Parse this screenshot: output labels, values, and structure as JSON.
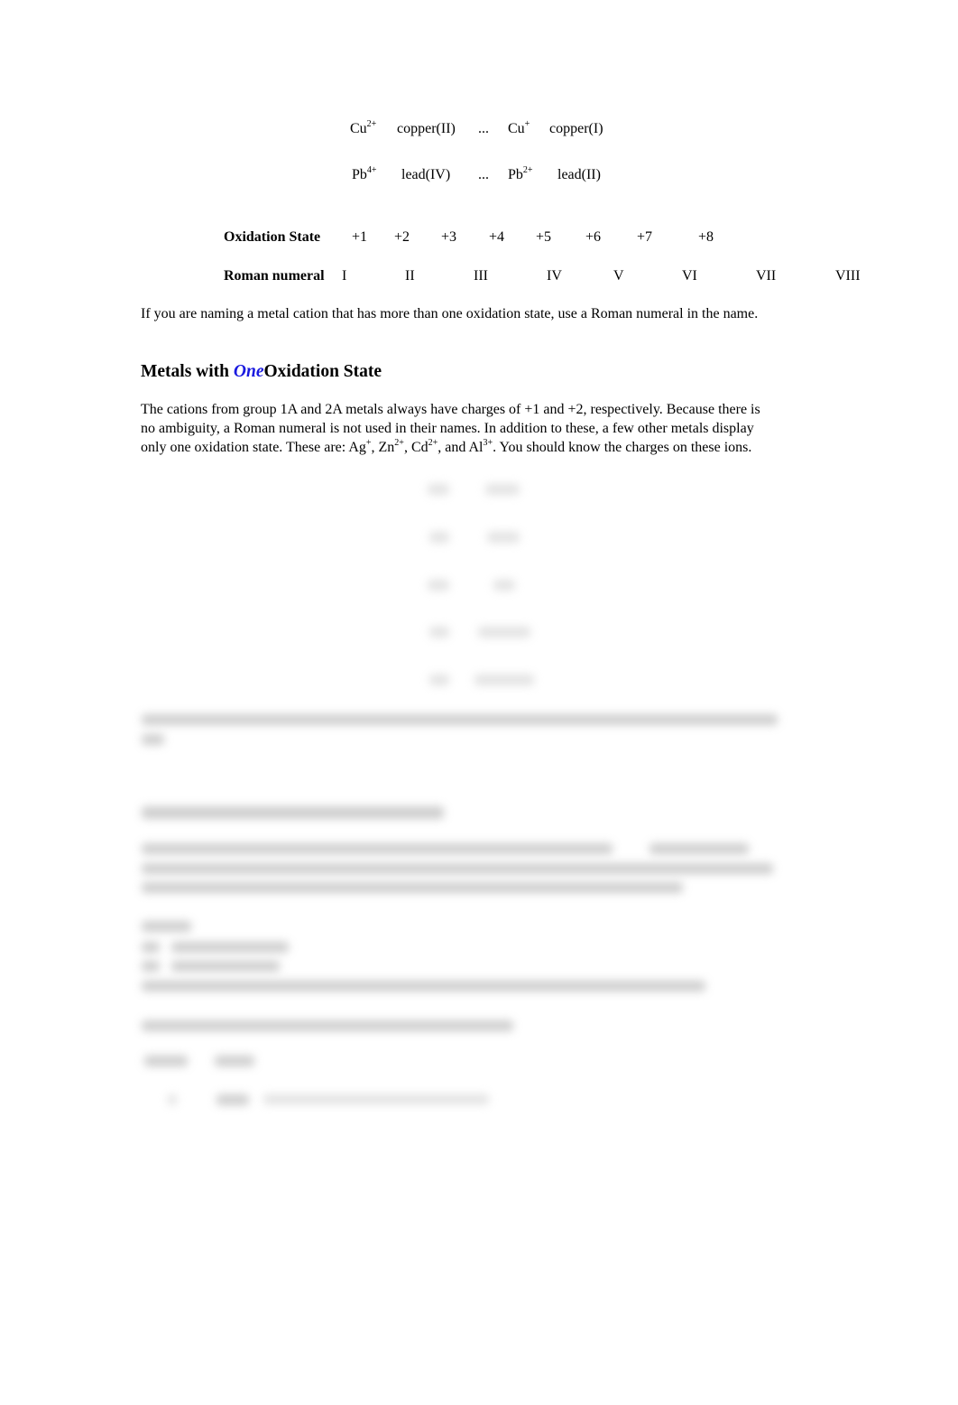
{
  "ion_examples": [
    {
      "ion1": "Cu",
      "charge1": "2+",
      "name1": "copper(II)",
      "sep": "...",
      "ion2": "Cu",
      "charge2": "+",
      "name2": "copper(I)"
    },
    {
      "ion1": "Pb",
      "charge1": "4+",
      "name1": "lead(IV)",
      "sep": "...",
      "ion2": "Pb",
      "charge2": "2+",
      "name2": "lead(II)"
    }
  ],
  "oxidation_table": {
    "state_label": "Oxidation State",
    "states": [
      "+1",
      "+2",
      "+3",
      "+4",
      "+5",
      "+6",
      "+7",
      "+8"
    ],
    "roman_label": "Roman numeral",
    "numerals": [
      "I",
      "II",
      "III",
      "IV",
      "V",
      "VI",
      "VII",
      "VIII"
    ]
  },
  "roman_rule": "If you are naming a metal cation that has more than one oxidation state, use a Roman numeral in the name.",
  "section_one": {
    "heading_prefix": "Metals with ",
    "heading_accent": "One",
    "heading_suffix": "Oxidation State",
    "accent_color": "#1a1adf",
    "para_line1": "The cations from group 1A and 2A metals always have charges of +1 and +2, respectively. Because there is",
    "para_line2": "no ambiguity, a Roman numeral is not used in their names. In addition to these, a few other metals display",
    "para_line3_start": "only one oxidation state. These are: ",
    "ions": [
      {
        "symbol": "Ag",
        "charge": "+",
        "after": ", "
      },
      {
        "symbol": "Zn",
        "charge": "2+",
        "after": ", "
      },
      {
        "symbol": "Cd",
        "charge": "2+",
        "after": ", and "
      },
      {
        "symbol": "Al",
        "charge": "3+",
        "after": ". "
      }
    ],
    "para_line3_end": "You should know the charges on these ions."
  },
  "blurred_content_notice": "remaining content blurred / not legible"
}
